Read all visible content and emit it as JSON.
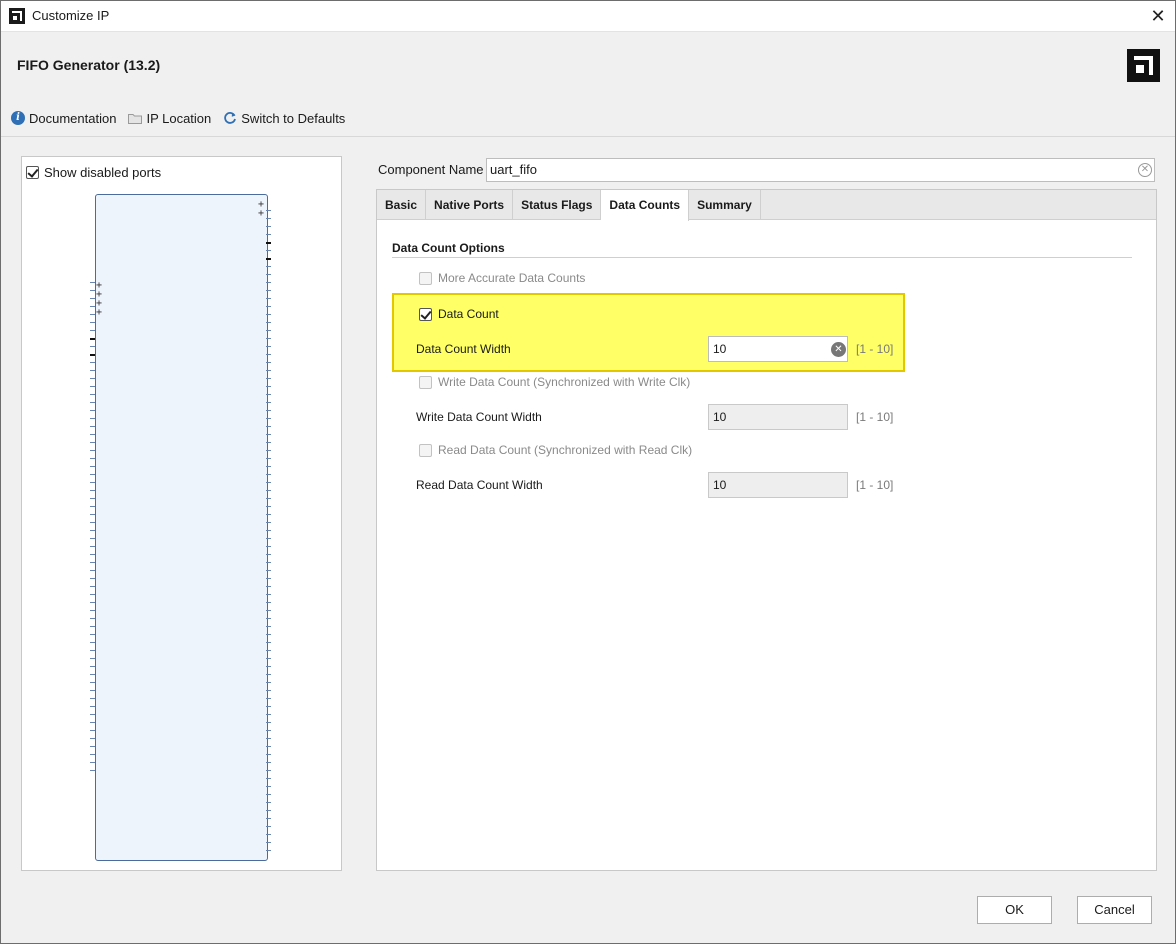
{
  "window": {
    "title": "Customize IP"
  },
  "header": {
    "title": "FIFO Generator (13.2)"
  },
  "toolbar": {
    "documentation": "Documentation",
    "ip_location": "IP Location",
    "switch_defaults": "Switch to Defaults"
  },
  "left_panel": {
    "show_disabled_ports": "Show disabled ports"
  },
  "component": {
    "label": "Component Name",
    "value": "uart_fifo"
  },
  "tabs": [
    {
      "label": "Basic"
    },
    {
      "label": "Native Ports"
    },
    {
      "label": "Status Flags"
    },
    {
      "label": "Data Counts",
      "active": true
    },
    {
      "label": "Summary"
    }
  ],
  "data_counts": {
    "section_title": "Data Count Options",
    "more_accurate": "More Accurate Data Counts",
    "data_count": "Data Count",
    "data_count_width_label": "Data Count Width",
    "data_count_width_value": "10",
    "data_count_width_range": "[1 - 10]",
    "write_data_count": "Write Data Count (Synchronized with Write Clk)",
    "write_data_count_width_label": "Write Data Count Width",
    "write_data_count_width_value": "10",
    "write_data_count_width_range": "[1 - 10]",
    "read_data_count": "Read Data Count (Synchronized with Read Clk)",
    "read_data_count_width_label": "Read Data Count Width",
    "read_data_count_width_value": "10",
    "read_data_count_width_range": "[1 - 10]"
  },
  "buttons": {
    "ok": "OK",
    "cancel": "Cancel"
  },
  "colors": {
    "highlight": "#ffff66",
    "highlight_border": "#e3c800",
    "info_icon": "#2e6fb5"
  }
}
